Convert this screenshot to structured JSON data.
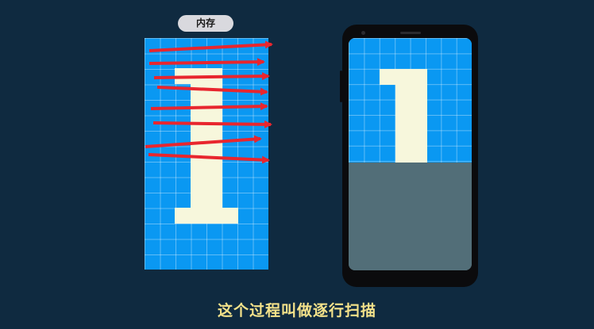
{
  "memory": {
    "label": "内存"
  },
  "caption": "这个过程叫做逐行扫描",
  "colors": {
    "background": "#0f2a40",
    "grid_blue": "#0a98f2",
    "glyph_cream": "#f7f7dc",
    "arrow_red": "#e8262e",
    "unscanned_gray": "#526e78",
    "caption_yellow": "#f4e28a"
  },
  "icons": {
    "arrow": "right-arrow-icon"
  }
}
